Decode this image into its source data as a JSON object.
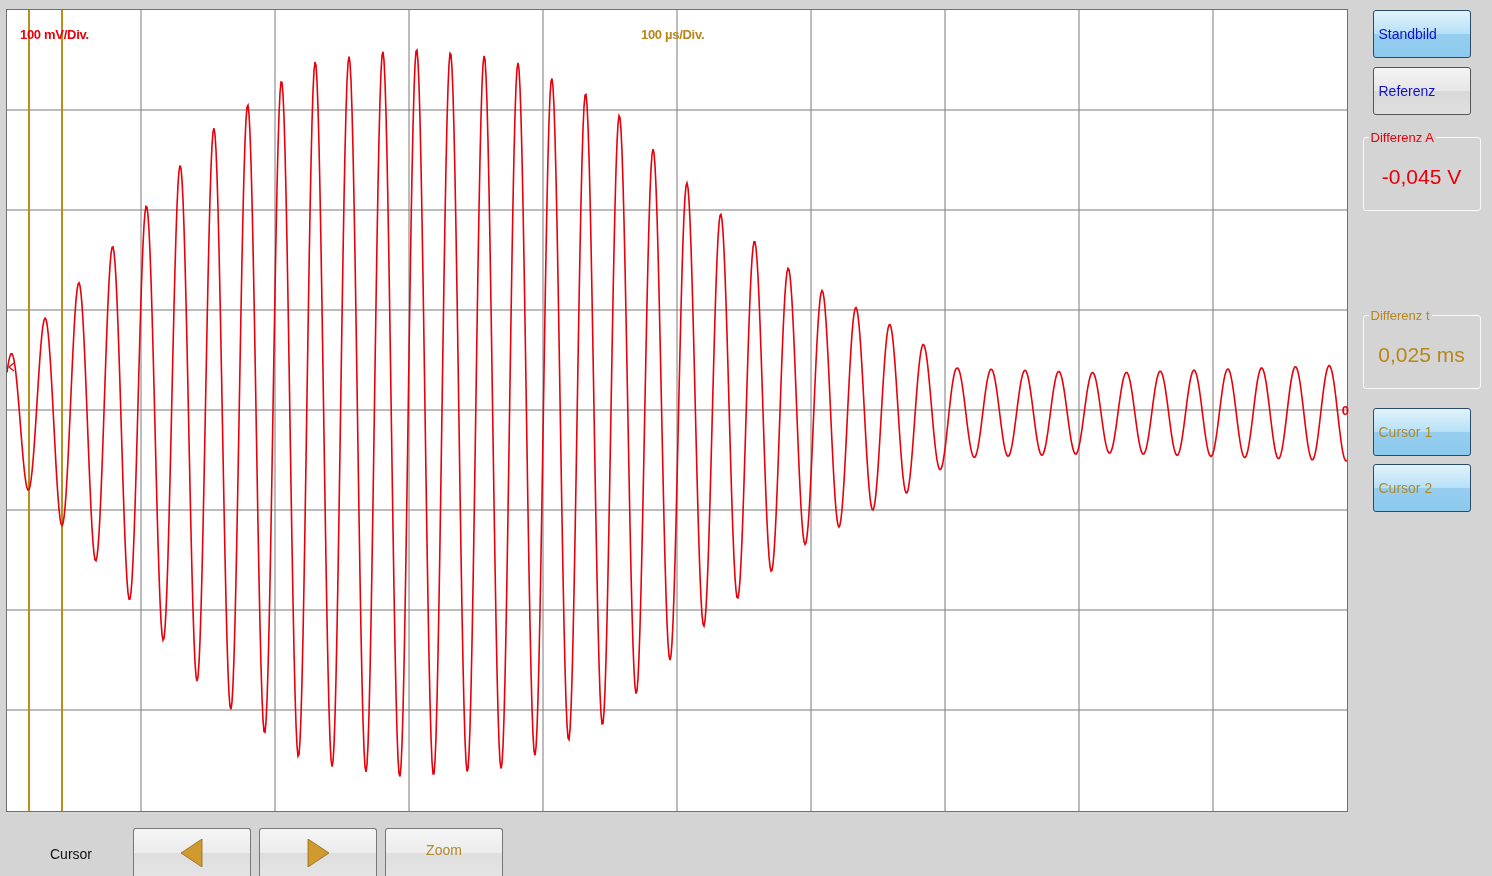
{
  "plot": {
    "volts_per_div": "100 mV/Div.",
    "time_per_div": "100 µs/Div.",
    "zero_label": "0"
  },
  "side_buttons": [
    {
      "label": "Standbild",
      "selected": true
    },
    {
      "label": "Referenz",
      "selected": false
    }
  ],
  "readouts": [
    {
      "title": "Differenz A",
      "value": "-0,045 V",
      "color": "#e8000b"
    },
    {
      "title": "Differenz t",
      "value": "0,025 ms",
      "color": "#b8861a"
    }
  ],
  "cursor_buttons": [
    {
      "label": "Cursor 1",
      "selected": true
    },
    {
      "label": "Cursor 2",
      "selected": true
    }
  ],
  "bottom": {
    "label": "Cursor",
    "zoom": "Zoom"
  }
}
